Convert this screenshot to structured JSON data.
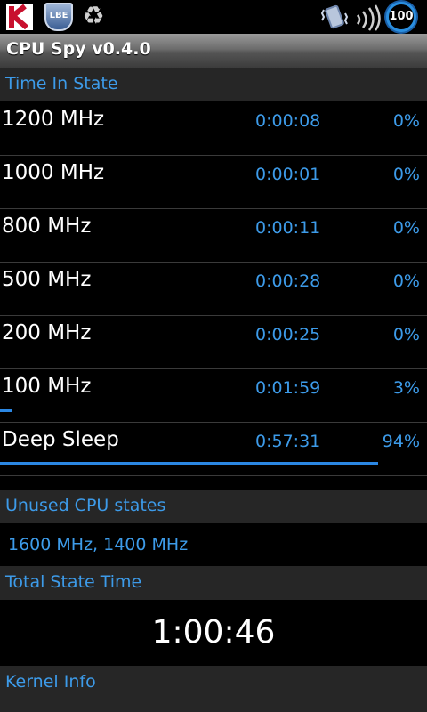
{
  "status_bar": {
    "lbe_label": "LBE",
    "recycle_glyph": "♻",
    "battery_level": "100",
    "icons": [
      "kaspersky-icon",
      "lbe-shield-icon",
      "recycle-icon",
      "vibrate-icon",
      "signal-icon",
      "battery-icon"
    ],
    "accent_color": "#2a8fe0"
  },
  "app": {
    "title": "CPU Spy v0.4.0"
  },
  "time_in_state": {
    "header": "Time In State",
    "states": [
      {
        "name": "1200 MHz",
        "time": "0:00:08",
        "percent": "0%",
        "fraction": 0.0
      },
      {
        "name": "1000 MHz",
        "time": "0:00:01",
        "percent": "0%",
        "fraction": 0.0
      },
      {
        "name": "800 MHz",
        "time": "0:00:11",
        "percent": "0%",
        "fraction": 0.0
      },
      {
        "name": "500 MHz",
        "time": "0:00:28",
        "percent": "0%",
        "fraction": 0.0
      },
      {
        "name": "200 MHz",
        "time": "0:00:25",
        "percent": "0%",
        "fraction": 0.0
      },
      {
        "name": "100 MHz",
        "time": "0:01:59",
        "percent": "3%",
        "fraction": 0.03
      },
      {
        "name": "Deep Sleep",
        "time": "0:57:31",
        "percent": "94%",
        "fraction": 0.94
      }
    ],
    "bar_color": "#2b87e3"
  },
  "unused_cpu_states": {
    "header": "Unused CPU states",
    "value": "1600 MHz, 1400 MHz"
  },
  "total_state_time": {
    "header": "Total State Time",
    "value": "1:00:46"
  },
  "kernel_info": {
    "header": "Kernel Info"
  },
  "colors": {
    "link_blue": "#3d9be9",
    "section_bg": "#262626",
    "background": "#000000"
  }
}
